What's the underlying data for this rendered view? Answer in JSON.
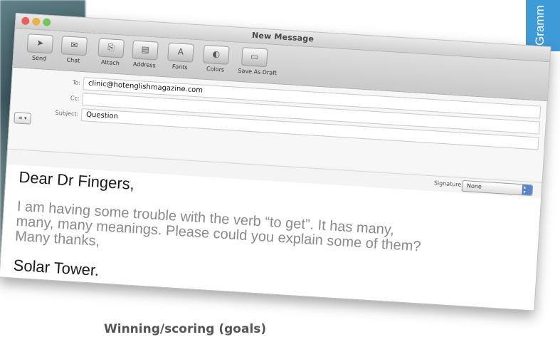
{
  "window": {
    "title": "New Message"
  },
  "toolbar": {
    "buttons": [
      {
        "label": "Send",
        "icon": "send-icon"
      },
      {
        "label": "Chat",
        "icon": "chat-icon"
      },
      {
        "label": "Attach",
        "icon": "attach-icon"
      },
      {
        "label": "Address",
        "icon": "address-icon"
      },
      {
        "label": "Fonts",
        "icon": "fonts-icon"
      },
      {
        "label": "Colors",
        "icon": "colors-icon"
      },
      {
        "label": "Save As Draft",
        "icon": "save-draft-icon"
      }
    ]
  },
  "fields": {
    "to_label": "To:",
    "to_value": "clinic@hotenglishmagazine.com",
    "cc_label": "Cc:",
    "cc_value": "",
    "subject_label": "Subject:",
    "subject_value": "Question"
  },
  "signature": {
    "label": "Signature:",
    "value": "None"
  },
  "message": {
    "greeting": "Dear Dr Fingers,",
    "body": "I am having some trouble with the verb “to get”. It has many,\nmany, many meanings. Please could you explain some of them?\nMany thanks,",
    "signoff": "Solar Tower."
  },
  "side_tab": {
    "label": "Gramm"
  },
  "section_heading": "Winning/scoring (goals)",
  "colors": {
    "tab_blue": "#3f9ad8"
  }
}
